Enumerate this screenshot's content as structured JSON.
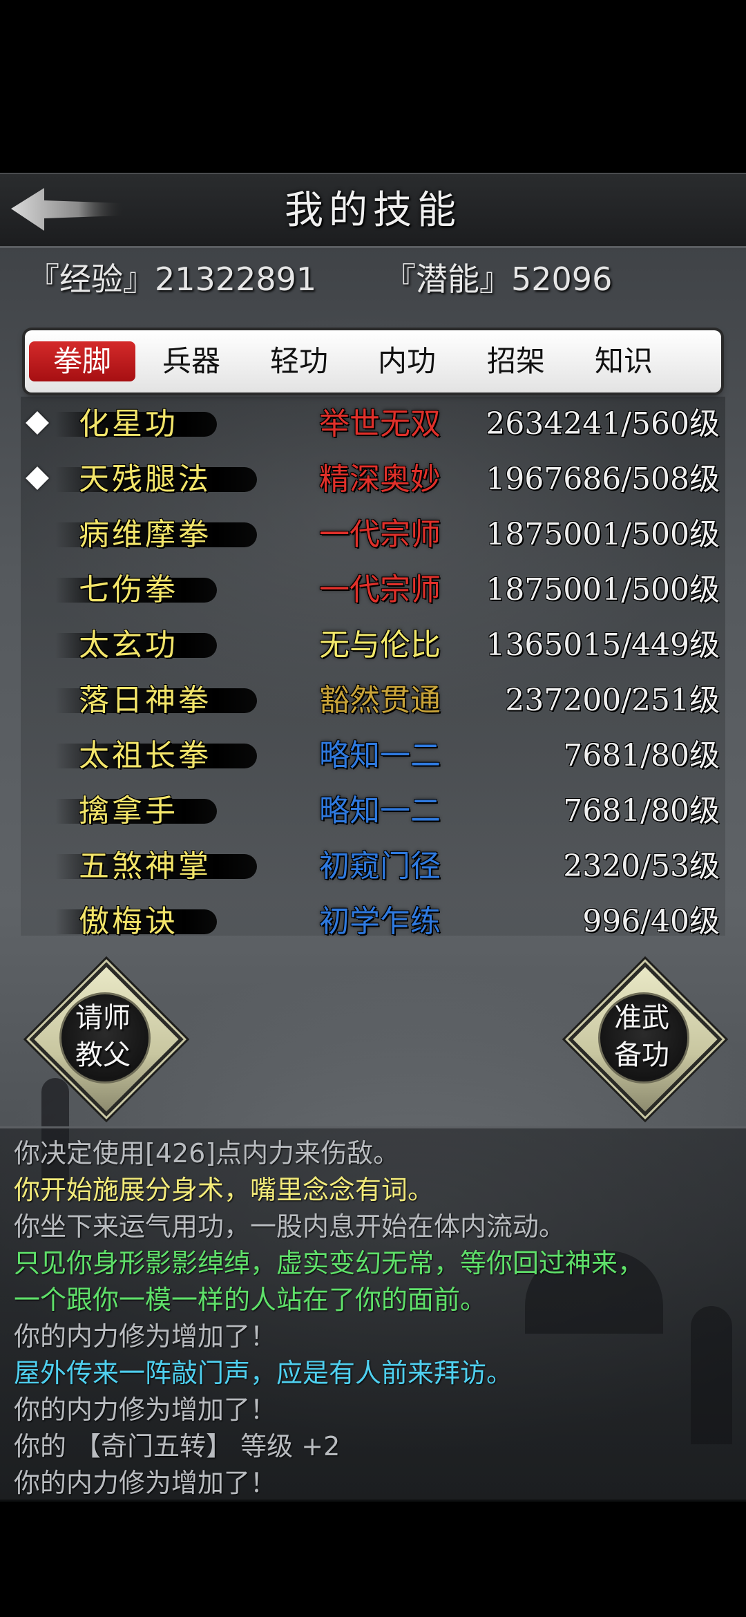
{
  "header": {
    "title": "我的技能",
    "back_icon": "left-arrow-icon"
  },
  "stats": {
    "experience": "『经验』21322891",
    "potential": "『潜能』52096"
  },
  "tabs": [
    {
      "label": "拳脚",
      "active": true
    },
    {
      "label": "兵器",
      "active": false
    },
    {
      "label": "轻功",
      "active": false
    },
    {
      "label": "内功",
      "active": false
    },
    {
      "label": "招架",
      "active": false
    },
    {
      "label": "知识",
      "active": false
    }
  ],
  "skills": [
    {
      "name": "化星功",
      "marked": true,
      "rank": "举世无双",
      "rank_color": "#e0302a",
      "level": "2634241/560级"
    },
    {
      "name": "天残腿法",
      "marked": true,
      "rank": "精深奥妙",
      "rank_color": "#e0302a",
      "level": "1967686/508级"
    },
    {
      "name": "病维摩拳",
      "marked": false,
      "rank": "一代宗师",
      "rank_color": "#e0302a",
      "level": "1875001/500级"
    },
    {
      "name": "七伤拳",
      "marked": false,
      "rank": "一代宗师",
      "rank_color": "#e0302a",
      "level": "1875001/500级"
    },
    {
      "name": "太玄功",
      "marked": false,
      "rank": "无与伦比",
      "rank_color": "#f2e86a",
      "level": "1365015/449级"
    },
    {
      "name": "落日神拳",
      "marked": false,
      "rank": "豁然贯通",
      "rank_color": "#c9a43a",
      "level": "237200/251级"
    },
    {
      "name": "太祖长拳",
      "marked": false,
      "rank": "略知一二",
      "rank_color": "#2f7ae0",
      "level": "7681/80级"
    },
    {
      "name": "擒拿手",
      "marked": false,
      "rank": "略知一二",
      "rank_color": "#2f7ae0",
      "level": "7681/80级"
    },
    {
      "name": "五煞神掌",
      "marked": false,
      "rank": "初窥门径",
      "rank_color": "#2f7ae0",
      "level": "2320/53级"
    },
    {
      "name": "傲梅诀",
      "marked": false,
      "rank": "初学乍练",
      "rank_color": "#2f7ae0",
      "level": "996/40级"
    }
  ],
  "buttons": {
    "teacher": {
      "line1": "请师",
      "line2": "教父"
    },
    "prepare": {
      "line1": "准武",
      "line2": "备功"
    }
  },
  "log": [
    {
      "text": "你决定使用[426]点内力来伤敌。",
      "color": "#b9bcc0"
    },
    {
      "text": "你开始施展分身术，嘴里念念有词。",
      "color": "#f2ea7a"
    },
    {
      "text": "你坐下来运气用功，一股内息开始在体内流动。",
      "color": "#b9bcc0"
    },
    {
      "text": "只见你身形影影绰绰，虚实变幻无常，等你回过神来，",
      "color": "#5fe06a"
    },
    {
      "text": "一个跟你一模一样的人站在了你的面前。",
      "color": "#5fe06a"
    },
    {
      "text": "你的内力修为增加了！",
      "color": "#b9bcc0"
    },
    {
      "text": "屋外传来一阵敲门声，应是有人前来拜访。",
      "color": "#4fd0f0"
    },
    {
      "text": "你的内力修为增加了！",
      "color": "#b9bcc0"
    },
    {
      "text": "你的 【奇门五转】 等级 +2",
      "color": "#b9bcc0"
    },
    {
      "text": "你的内力修为增加了！",
      "color": "#b9bcc0"
    }
  ]
}
